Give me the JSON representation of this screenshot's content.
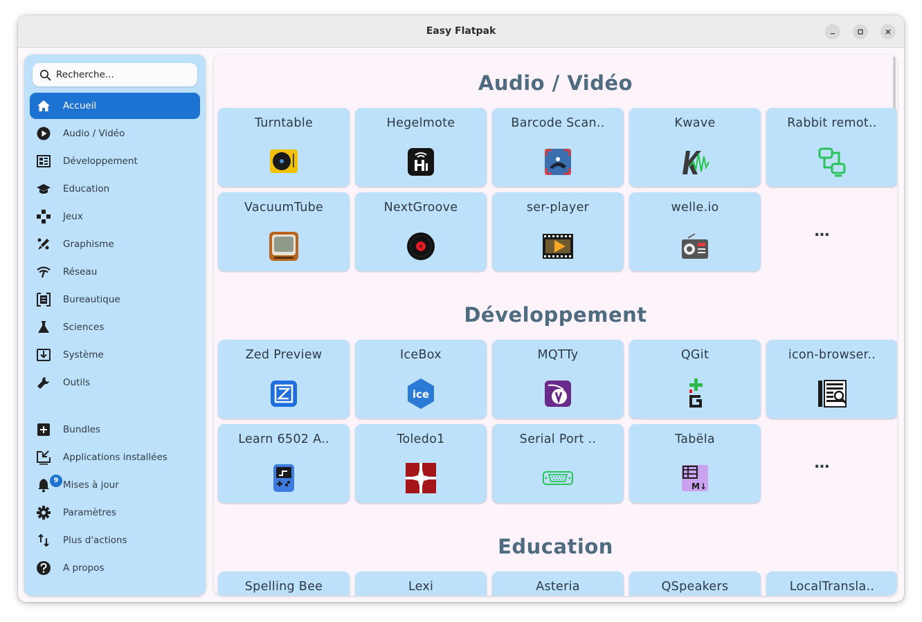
{
  "window": {
    "title": "Easy Flatpak"
  },
  "search": {
    "placeholder": "Recherche..."
  },
  "sidebar": {
    "items": [
      {
        "label": "Accueil",
        "icon": "home-icon",
        "active": true
      },
      {
        "label": "Audio / Vidéo",
        "icon": "play-icon"
      },
      {
        "label": "Développement",
        "icon": "development-icon"
      },
      {
        "label": "Education",
        "icon": "graduation-cap-icon"
      },
      {
        "label": "Jeux",
        "icon": "gamepad-icon"
      },
      {
        "label": "Graphisme",
        "icon": "brush-icon"
      },
      {
        "label": "Réseau",
        "icon": "network-icon"
      },
      {
        "label": "Bureautique",
        "icon": "document-icon"
      },
      {
        "label": "Sciences",
        "icon": "flask-icon"
      },
      {
        "label": "Système",
        "icon": "download-box-icon"
      },
      {
        "label": "Outils",
        "icon": "wrench-icon"
      }
    ],
    "bottom_items": [
      {
        "label": "Bundles",
        "icon": "plus-square-icon"
      },
      {
        "label": "Applications installées",
        "icon": "installed-apps-icon"
      },
      {
        "label": "Mises à jour",
        "icon": "bell-icon",
        "badge": "9"
      },
      {
        "label": "Paramètres",
        "icon": "gear-icon"
      },
      {
        "label": "Plus d'actions",
        "icon": "sort-arrows-icon"
      },
      {
        "label": "A propos",
        "icon": "help-icon"
      }
    ]
  },
  "sections": [
    {
      "title": "Audio / Vidéo",
      "apps": [
        {
          "name": "Turntable",
          "icon": "turntable-icon"
        },
        {
          "name": "Hegelmote",
          "icon": "hegelmote-icon"
        },
        {
          "name": "Barcode Scan..",
          "icon": "barcode-scanner-icon"
        },
        {
          "name": "Kwave",
          "icon": "kwave-icon"
        },
        {
          "name": "Rabbit remot..",
          "icon": "rabbit-remote-icon"
        },
        {
          "name": "VacuumTube",
          "icon": "vacuumtube-icon"
        },
        {
          "name": "NextGroove",
          "icon": "nextgroove-icon"
        },
        {
          "name": "ser-player",
          "icon": "ser-player-icon"
        },
        {
          "name": "welle.io",
          "icon": "welle-io-icon"
        }
      ],
      "more": "..."
    },
    {
      "title": "Développement",
      "apps": [
        {
          "name": "Zed Preview",
          "icon": "zed-preview-icon"
        },
        {
          "name": "IceBox",
          "icon": "icebox-icon"
        },
        {
          "name": "MQTTy",
          "icon": "mqtty-icon"
        },
        {
          "name": "QGit",
          "icon": "qgit-icon"
        },
        {
          "name": "icon-browser..",
          "icon": "icon-browser-icon"
        },
        {
          "name": "Learn 6502 A..",
          "icon": "learn-6502-icon"
        },
        {
          "name": "Toledo1",
          "icon": "toledo1-icon"
        },
        {
          "name": "Serial Port ..",
          "icon": "serial-port-icon"
        },
        {
          "name": "Tabëla",
          "icon": "tabela-icon"
        }
      ],
      "more": "..."
    },
    {
      "title": "Education",
      "apps": [
        {
          "name": "Spelling Bee"
        },
        {
          "name": "Lexi"
        },
        {
          "name": "Asteria"
        },
        {
          "name": "QSpeakers"
        },
        {
          "name": "LocalTransla.."
        }
      ]
    }
  ],
  "colors": {
    "accent": "#1d73d2",
    "sidebar_bg": "#bde0fb",
    "card_bg": "#bde0fb",
    "content_bg": "#fdf4fb",
    "section_title": "#4f6b7f"
  }
}
